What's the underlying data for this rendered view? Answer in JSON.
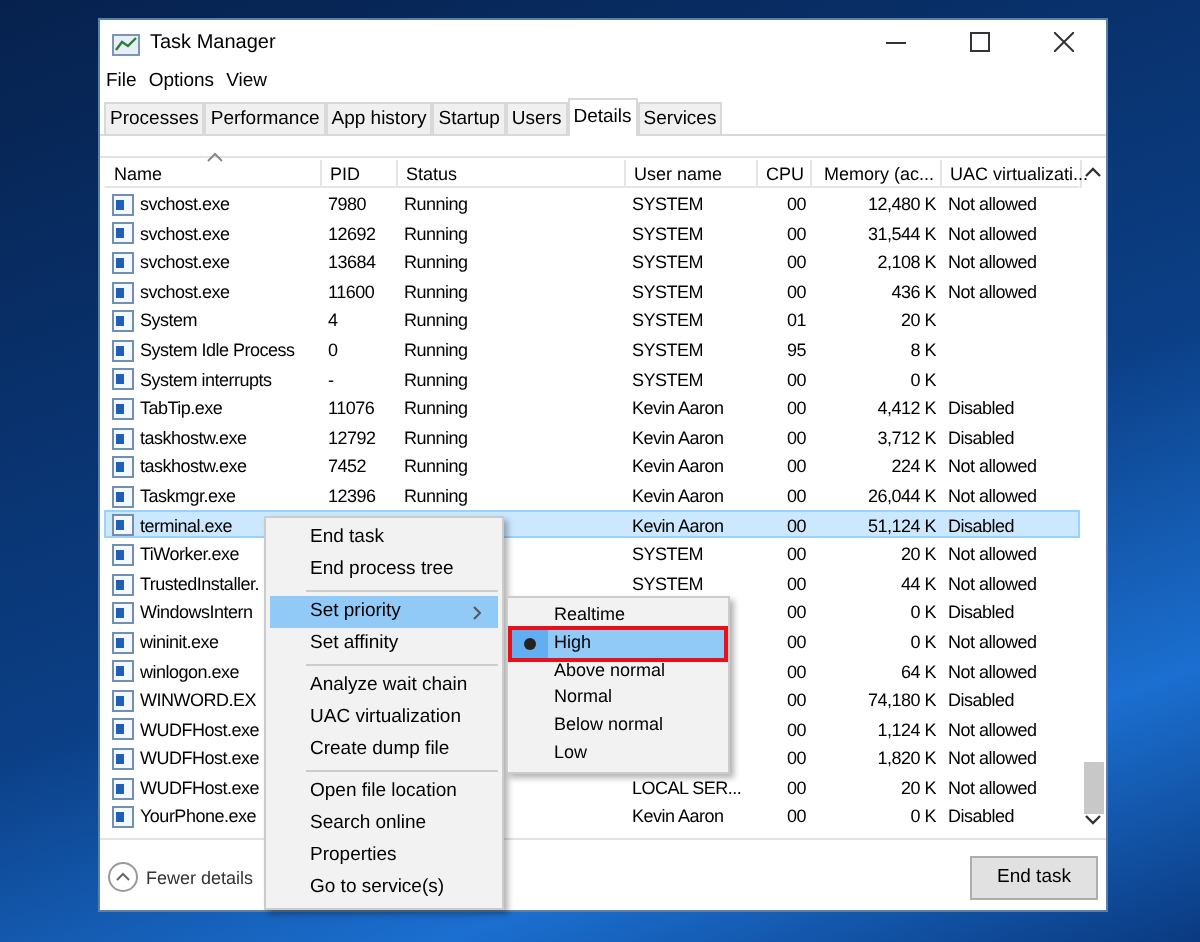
{
  "window": {
    "title": "Task Manager"
  },
  "menu_bar": [
    "File",
    "Options",
    "View"
  ],
  "tabs": [
    {
      "label": "Processes",
      "selected": false
    },
    {
      "label": "Performance",
      "selected": false
    },
    {
      "label": "App history",
      "selected": false
    },
    {
      "label": "Startup",
      "selected": false
    },
    {
      "label": "Users",
      "selected": false
    },
    {
      "label": "Details",
      "selected": true
    },
    {
      "label": "Services",
      "selected": false
    }
  ],
  "table": {
    "columns": [
      {
        "label": "Name",
        "sorted": true
      },
      {
        "label": "PID",
        "sorted": false
      },
      {
        "label": "Status",
        "sorted": false
      },
      {
        "label": "User name",
        "sorted": false
      },
      {
        "label": "CPU",
        "sorted": false
      },
      {
        "label": "Memory (ac...",
        "sorted": false
      },
      {
        "label": "UAC virtualizati...",
        "sorted": false
      }
    ],
    "rows": [
      {
        "name": "svchost.exe",
        "pid": "7980",
        "status": "Running",
        "user": "SYSTEM",
        "cpu": "00",
        "memory": "12,480 K",
        "uac": "Not allowed",
        "selected": false
      },
      {
        "name": "svchost.exe",
        "pid": "12692",
        "status": "Running",
        "user": "SYSTEM",
        "cpu": "00",
        "memory": "31,544 K",
        "uac": "Not allowed",
        "selected": false
      },
      {
        "name": "svchost.exe",
        "pid": "13684",
        "status": "Running",
        "user": "SYSTEM",
        "cpu": "00",
        "memory": "2,108 K",
        "uac": "Not allowed",
        "selected": false
      },
      {
        "name": "svchost.exe",
        "pid": "11600",
        "status": "Running",
        "user": "SYSTEM",
        "cpu": "00",
        "memory": "436 K",
        "uac": "Not allowed",
        "selected": false
      },
      {
        "name": "System",
        "pid": "4",
        "status": "Running",
        "user": "SYSTEM",
        "cpu": "01",
        "memory": "20 K",
        "selected": false
      },
      {
        "name": "System Idle Process",
        "pid": "0",
        "status": "Running",
        "user": "SYSTEM",
        "cpu": "95",
        "memory": "8 K",
        "selected": false
      },
      {
        "name": "System interrupts",
        "pid": "-",
        "status": "Running",
        "user": "SYSTEM",
        "cpu": "00",
        "memory": "0 K",
        "selected": false
      },
      {
        "name": "TabTip.exe",
        "pid": "11076",
        "status": "Running",
        "user": "Kevin Aaron",
        "cpu": "00",
        "memory": "4,412 K",
        "uac": "Disabled",
        "selected": false
      },
      {
        "name": "taskhostw.exe",
        "pid": "12792",
        "status": "Running",
        "user": "Kevin Aaron",
        "cpu": "00",
        "memory": "3,712 K",
        "uac": "Disabled",
        "selected": false
      },
      {
        "name": "taskhostw.exe",
        "pid": "7452",
        "status": "Running",
        "user": "Kevin Aaron",
        "cpu": "00",
        "memory": "224 K",
        "uac": "Not allowed",
        "selected": false
      },
      {
        "name": "Taskmgr.exe",
        "pid": "12396",
        "status": "Running",
        "user": "Kevin Aaron",
        "cpu": "00",
        "memory": "26,044 K",
        "uac": "Not allowed",
        "selected": false
      },
      {
        "name": "terminal.exe",
        "user": "Kevin Aaron",
        "cpu": "00",
        "memory": "51,124 K",
        "uac": "Disabled",
        "selected": true
      },
      {
        "name": "TiWorker.exe",
        "user": "SYSTEM",
        "cpu": "00",
        "memory": "20 K",
        "uac": "Not allowed",
        "selected": false
      },
      {
        "name": "TrustedInstaller.",
        "user": "SYSTEM",
        "cpu": "00",
        "memory": "44 K",
        "uac": "Not allowed",
        "selected": false
      },
      {
        "name": "WindowsIntern",
        "cpu": "00",
        "memory": "0 K",
        "uac": "Disabled",
        "selected": false
      },
      {
        "name": "wininit.exe",
        "cpu": "00",
        "memory": "0 K",
        "uac": "Not allowed",
        "selected": false
      },
      {
        "name": "winlogon.exe",
        "cpu": "00",
        "memory": "64 K",
        "uac": "Not allowed",
        "selected": false
      },
      {
        "name": "WINWORD.EX",
        "cpu": "00",
        "memory": "74,180 K",
        "uac": "Disabled",
        "selected": false
      },
      {
        "name": "WUDFHost.exe",
        "cpu": "00",
        "memory": "1,124 K",
        "uac": "Not allowed",
        "selected": false
      },
      {
        "name": "WUDFHost.exe",
        "cpu": "00",
        "memory": "1,820 K",
        "uac": "Not allowed",
        "selected": false
      },
      {
        "name": "WUDFHost.exe",
        "user": "LOCAL SER...",
        "cpu": "00",
        "memory": "20 K",
        "uac": "Not allowed",
        "selected": false
      },
      {
        "name": "YourPhone.exe",
        "user": "Kevin Aaron",
        "cpu": "00",
        "memory": "0 K",
        "uac": "Disabled",
        "selected": false
      }
    ]
  },
  "footer": {
    "fewer_details": "Fewer details",
    "end_task": "End task"
  },
  "context_menu": {
    "groups": [
      [
        {
          "label": "End task",
          "selected": false,
          "has_submenu": false
        },
        {
          "label": "End process tree",
          "selected": false,
          "has_submenu": false
        }
      ],
      [
        {
          "label": "Set priority",
          "selected": true,
          "has_submenu": true
        },
        {
          "label": "Set affinity",
          "selected": false,
          "has_submenu": false
        }
      ],
      [
        {
          "label": "Analyze wait chain",
          "selected": false,
          "has_submenu": false
        },
        {
          "label": "UAC virtualization",
          "selected": false,
          "has_submenu": false
        },
        {
          "label": "Create dump file",
          "selected": false,
          "has_submenu": false
        }
      ],
      [
        {
          "label": "Open file location",
          "selected": false,
          "has_submenu": false
        },
        {
          "label": "Search online",
          "selected": false,
          "has_submenu": false
        },
        {
          "label": "Properties",
          "selected": false,
          "has_submenu": false
        },
        {
          "label": "Go to service(s)",
          "selected": false,
          "has_submenu": false
        }
      ]
    ]
  },
  "priority_submenu": {
    "items": [
      {
        "label": "Realtime",
        "selected": false,
        "checked": false,
        "outlined": false
      },
      {
        "label": "High",
        "selected": true,
        "checked": true,
        "outlined": true
      },
      {
        "label": "Above normal",
        "selected": false,
        "checked": false,
        "outlined": false
      },
      {
        "label": "Normal",
        "selected": false,
        "checked": false,
        "outlined": false
      },
      {
        "label": "Below normal",
        "selected": false,
        "checked": false,
        "outlined": false
      },
      {
        "label": "Low",
        "selected": false,
        "checked": false,
        "outlined": false
      }
    ]
  }
}
